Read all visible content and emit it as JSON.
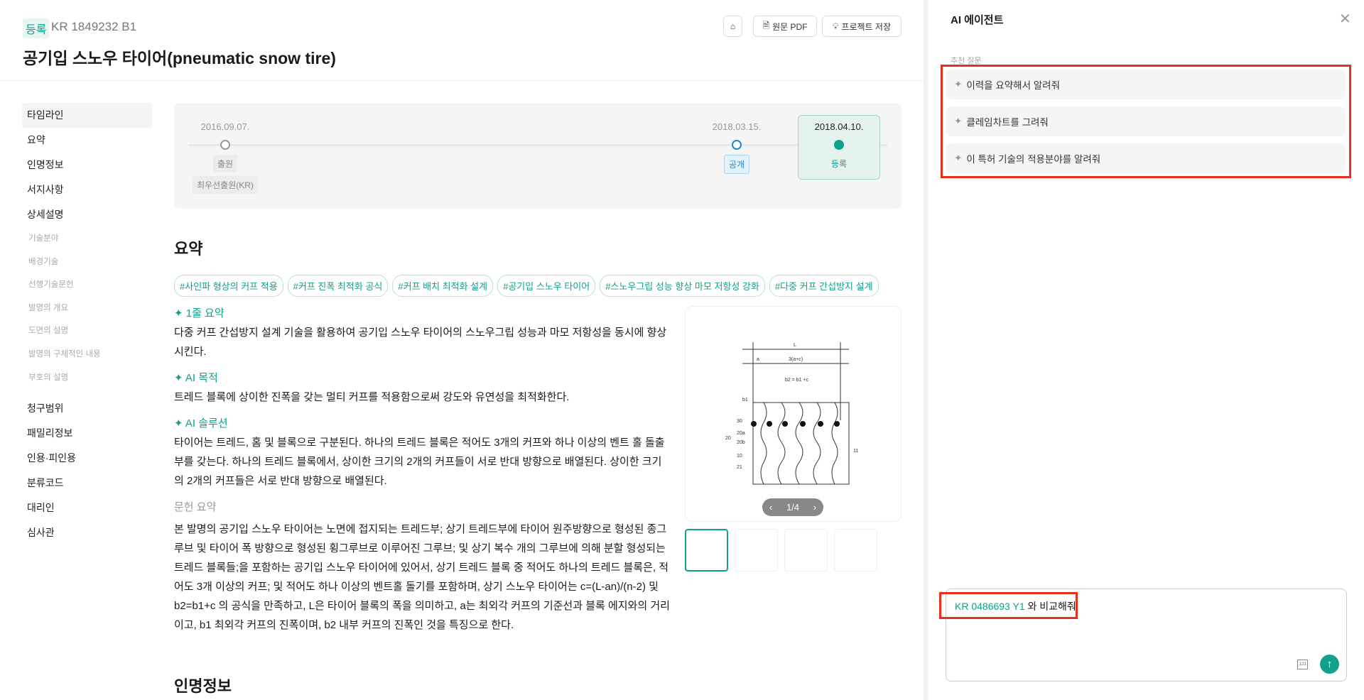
{
  "header": {
    "status_badge": "등록",
    "patent_number": "KR 1849232 B1",
    "title": "공기입 스노우 타이어(pneumatic snow tire)",
    "pdf_button": "원문 PDF",
    "save_button": "프로젝트 저장"
  },
  "sidebar": {
    "items": [
      "타임라인",
      "요약",
      "인명정보",
      "서지사항",
      "상세설명"
    ],
    "sub_items": [
      "기술분야",
      "배경기술",
      "선행기술문헌",
      "발명의 개요",
      "도면의 설명",
      "발명의 구체적인 내용",
      "부호의 설명"
    ],
    "items2": [
      "청구범위",
      "패밀리정보",
      "인용·피인용",
      "분류코드",
      "대리인",
      "심사관"
    ]
  },
  "timeline": [
    {
      "date": "2016.09.07.",
      "label": "출원",
      "sublabel": "최우선출원(KR)"
    },
    {
      "date": "2018.03.15.",
      "label": "공개"
    },
    {
      "date": "2018.04.10.",
      "label": "등록"
    }
  ],
  "summary": {
    "heading": "요약",
    "tags": [
      "#사인파 형상의 커프 적용",
      "#커프 진폭 최적화 공식",
      "#커프 배치 최적화 설계",
      "#공기입 스노우 타이어",
      "#스노우그립 성능 향상 마모 저항성 강화",
      "#다중 커프 간섭방지 설계"
    ],
    "one_line_label": "1줄 요약",
    "one_line": "다중 커프 간섭방지 설계 기술을 활용하여 공기입 스노우 타이어의 스노우그립 성능과 마모 저항성을 동시에 향상시킨다.",
    "purpose_label": "AI 목적",
    "purpose": "트레드 블록에 상이한 진폭을 갖는 멀티 커프를 적용함으로써 강도와 유연성을 최적화한다.",
    "solution_label": "AI 솔루션",
    "solution": "타이어는 트레드, 홈 및 블록으로 구분된다. 하나의 트레드 블록은 적어도 3개의 커프와 하나 이상의 벤트 홀 돌출부를 갖는다. 하나의 트레드 블록에서, 상이한 크기의 2개의 커프들이 서로 반대 방향으로 배열된다. 상이한 크기의 2개의 커프들은 서로 반대 방향으로 배열된다.",
    "doc_label": "문헌 요약",
    "doc": "본 발명의 공기입 스노우 타이어는 노면에 접지되는 트레드부; 상기 트레드부에 타이어 원주방향으로 형성된 종그루브 및 타이어 폭 방향으로 형성된 횡그루브로 이루어진 그루브; 및 상기 복수 개의 그루브에 의해 분할 형성되는 트레드 블록들;을 포함하는 공기입 스노우 타이어에 있어서, 상기 트레드 블록 중 적어도 하나의 트레드 블록은, 적어도 3개 이상의 커프; 및 적어도 하나 이상의 벤트홀 돌기를 포함하며, 상기 스노우 타이어는 c=(L-an)/(n-2) 및 b2=b1+c 의 공식을 만족하고, L은 타이어 블록의 폭을 의미하고, a는 최외각 커프의 기준선과 블록 에지와의 거리이고, b1 최외각 커프의 진폭이며, b2 내부 커프의 진폭인 것을 특징으로 한다.",
    "pager": "1/4",
    "drawing_labels": [
      "L",
      "a",
      "3(a+c)",
      "b2 = b1 +c",
      "b1",
      "30",
      "20a",
      "20b",
      "20",
      "11",
      "10",
      "21"
    ]
  },
  "next_heading": "인명정보",
  "agent": {
    "title": "AI 에이전트",
    "suggest_label": "추천 질문",
    "suggestions": [
      "이력을 요약해서 알려줘",
      "클레임차트를 그려줘",
      "이 특허 기술의 적용분야를 알려줘"
    ],
    "input_ref": "KR 0486693 Y1",
    "input_text": " 와 비교해줘",
    "kbd": "123"
  },
  "colors": {
    "accent": "#12a08a",
    "highlight": "#e8301c"
  }
}
